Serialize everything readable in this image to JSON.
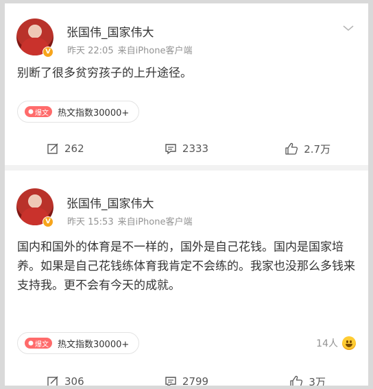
{
  "posts": [
    {
      "username": "张国伟_国家伟大",
      "time": "昨天 22:05",
      "source": "来自iPhone客户端",
      "content": "别断了很多贫穷孩子的上升途径。",
      "hot_tag": "爆文",
      "hot_index": "热文指数30000+",
      "actions": {
        "repost": "262",
        "comment": "2333",
        "like": "2.7万"
      }
    },
    {
      "username": "张国伟_国家伟大",
      "time": "昨天 15:53",
      "source": "来自iPhone客户端",
      "content": "国内和国外的体育是不一样的，国外是自己花钱。国内是国家培养。如果是自己花钱练体育我肯定不会练的。我家也没那么多钱来支持我。更不会有今天的成就。",
      "hot_tag": "爆文",
      "hot_index": "热文指数30000+",
      "readers": "14人",
      "actions": {
        "repost": "306",
        "comment": "2799",
        "like": "3万"
      }
    }
  ],
  "icons": {
    "verified": "V",
    "menu": "chevron-down-icon",
    "repost": "share-icon",
    "comment": "comment-icon",
    "like": "thumbs-up-icon"
  }
}
